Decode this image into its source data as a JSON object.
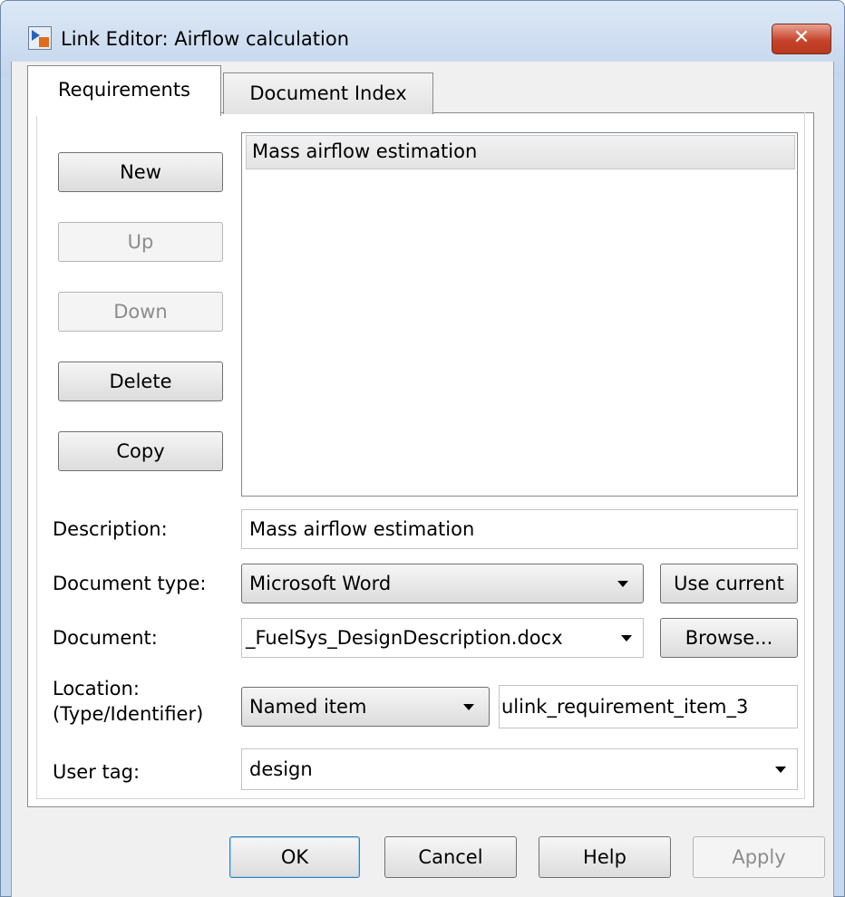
{
  "window": {
    "title": "Link Editor: Airflow calculation",
    "close_glyph": "✕"
  },
  "tabs": [
    {
      "label": "Requirements",
      "active": true
    },
    {
      "label": "Document Index",
      "active": false
    }
  ],
  "side_buttons": {
    "new": "New",
    "up": "Up",
    "down": "Down",
    "delete": "Delete",
    "copy": "Copy"
  },
  "requirements_list": {
    "items": [
      "Mass airflow estimation"
    ]
  },
  "form": {
    "description": {
      "label": "Description:",
      "value": "Mass airflow estimation"
    },
    "document_type": {
      "label": "Document type:",
      "value": "Microsoft Word",
      "use_current": "Use current"
    },
    "document": {
      "label": "Document:",
      "value": "_FuelSys_DesignDescription.docx",
      "browse": "Browse..."
    },
    "location": {
      "label_line1": "Location:",
      "label_line2": "(Type/Identifier)",
      "type": "Named item",
      "identifier": "ulink_requirement_item_3"
    },
    "user_tag": {
      "label": "User tag:",
      "value": "design"
    }
  },
  "dialog_buttons": {
    "ok": "OK",
    "cancel": "Cancel",
    "help": "Help",
    "apply": "Apply"
  },
  "icons": {
    "app": "simulink-link-icon",
    "close": "close-icon",
    "dropdown": "chevron-down-icon"
  }
}
